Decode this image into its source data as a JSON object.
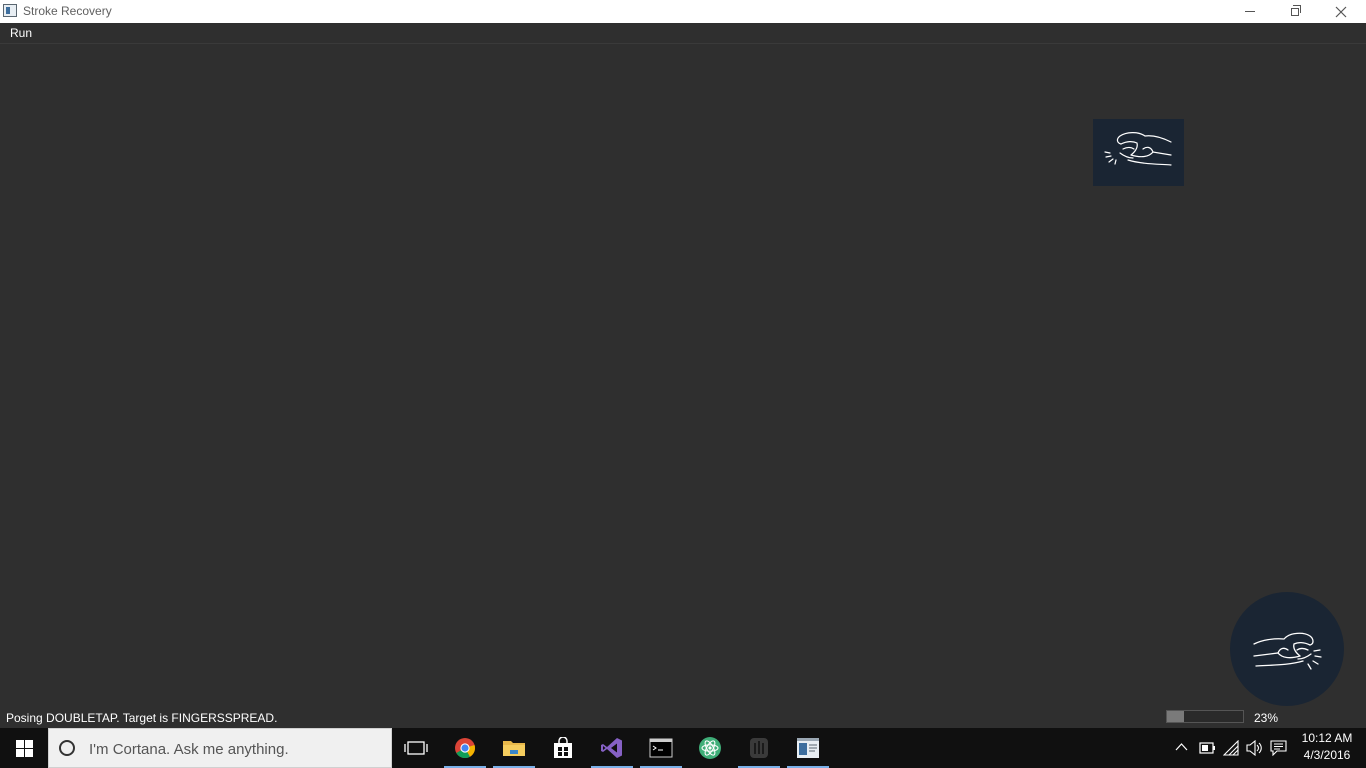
{
  "window": {
    "title": "Stroke Recovery"
  },
  "menu": {
    "items": [
      "Run"
    ]
  },
  "status": {
    "message": "Posing DOUBLETAP. Target is FINGERSSPREAD.",
    "progress_percent": 23,
    "progress_label": "23%"
  },
  "gestures": {
    "target_icon": "hand-pinch-icon",
    "current_pose_icon": "hand-pinch-icon"
  },
  "taskbar": {
    "search_placeholder": "I'm Cortana. Ask me anything.",
    "apps": [
      "task-view",
      "chrome",
      "file-explorer",
      "store",
      "visual-studio",
      "terminal",
      "atom",
      "app-dark",
      "stroke-recovery"
    ],
    "clock_time": "10:12 AM",
    "clock_date": "4/3/2016"
  },
  "colors": {
    "app_background": "#2f2f2f",
    "gesture_tile": "#1a2533",
    "taskbar": "#101010"
  }
}
